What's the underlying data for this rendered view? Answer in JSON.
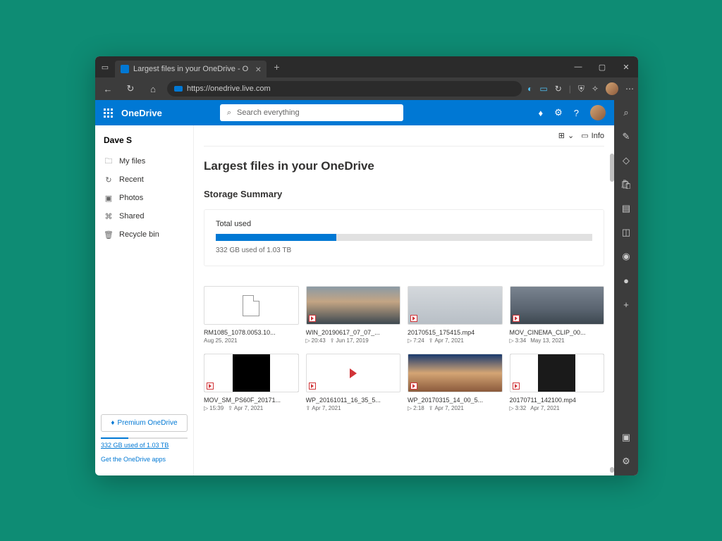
{
  "browser": {
    "tab_title": "Largest files in your OneDrive - O",
    "url": "https://onedrive.live.com"
  },
  "header": {
    "app_name": "OneDrive",
    "search_placeholder": "Search everything"
  },
  "sidebar": {
    "user_name": "Dave S",
    "items": [
      {
        "label": "My files"
      },
      {
        "label": "Recent"
      },
      {
        "label": "Photos"
      },
      {
        "label": "Shared"
      },
      {
        "label": "Recycle bin"
      }
    ],
    "premium_label": "Premium OneDrive",
    "storage_summary": "332 GB used of 1.03 TB",
    "get_apps": "Get the OneDrive apps"
  },
  "toolbar": {
    "info_label": "Info"
  },
  "page": {
    "title": "Largest files in your OneDrive",
    "section_title": "Storage Summary",
    "storage": {
      "label": "Total used",
      "text": "332 GB used of 1.03 TB",
      "percent": 32
    }
  },
  "files": [
    {
      "name": "RM1085_1078.0053.10...",
      "date": "Aug 25, 2021",
      "duration": "",
      "shared_date": ""
    },
    {
      "name": "WIN_20190617_07_07_...",
      "date": "",
      "duration": "20:43",
      "shared_date": "Jun 17, 2019"
    },
    {
      "name": "20170515_175415.mp4",
      "date": "",
      "duration": "7:24",
      "shared_date": "Apr 7, 2021"
    },
    {
      "name": "MOV_CINEMA_CLIP_00...",
      "date": "May 13, 2021",
      "duration": "3:34",
      "shared_date": ""
    },
    {
      "name": "MOV_SM_PS60F_20171...",
      "date": "",
      "duration": "15:39",
      "shared_date": "Apr 7, 2021"
    },
    {
      "name": "WP_20161011_16_35_5...",
      "date": "",
      "duration": "",
      "shared_date": "Apr 7, 2021"
    },
    {
      "name": "WP_20170315_14_00_5...",
      "date": "",
      "duration": "2:18",
      "shared_date": "Apr 7, 2021"
    },
    {
      "name": "20170711_142100.mp4",
      "date": "Apr 7, 2021",
      "duration": "3:32",
      "shared_date": ""
    }
  ]
}
